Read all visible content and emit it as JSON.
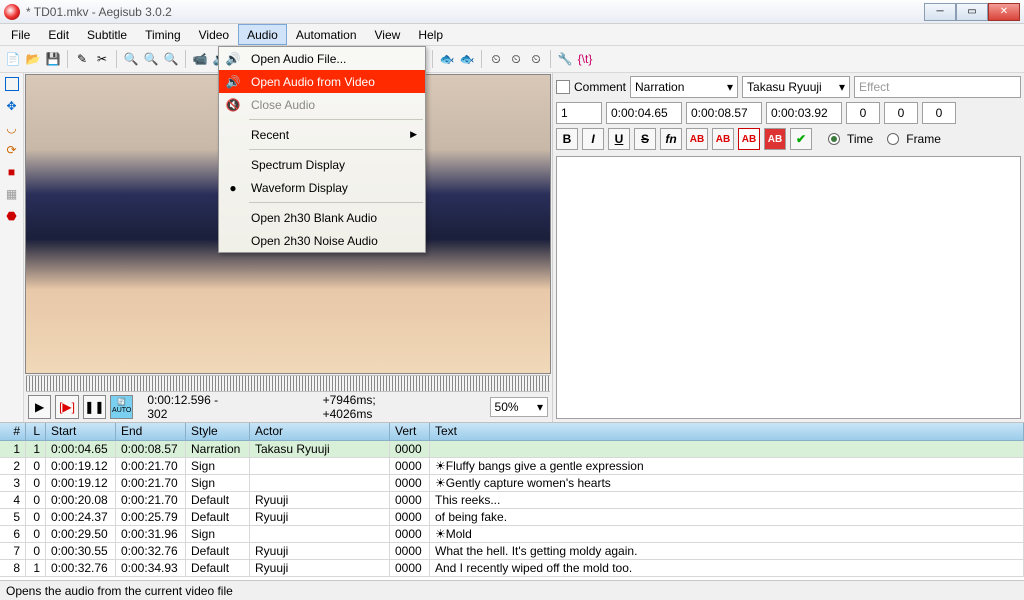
{
  "title": "* TD01.mkv - Aegisub 3.0.2",
  "menus": [
    "File",
    "Edit",
    "Subtitle",
    "Timing",
    "Video",
    "Audio",
    "Automation",
    "View",
    "Help"
  ],
  "audio_menu": {
    "open_file": "Open Audio File...",
    "open_from_video": "Open Audio from Video",
    "close": "Close Audio",
    "recent": "Recent",
    "spectrum": "Spectrum Display",
    "waveform": "Waveform Display",
    "blank": "Open 2h30 Blank Audio",
    "noise": "Open 2h30 Noise Audio"
  },
  "playback": {
    "timecode": "0:00:12.596 - 302",
    "offset": "+7946ms; +4026ms",
    "zoom": "50%"
  },
  "editpanel": {
    "comment_label": "Comment",
    "style": "Narration",
    "actor": "Takasu Ryuuji",
    "effect_ph": "Effect",
    "layer": "1",
    "start": "0:00:04.65",
    "end": "0:00:08.57",
    "dur": "0:00:03.92",
    "ml": "0",
    "mr": "0",
    "mv": "0",
    "time_label": "Time",
    "frame_label": "Frame"
  },
  "grid": {
    "headers": {
      "n": "#",
      "l": "L",
      "start": "Start",
      "end": "End",
      "style": "Style",
      "actor": "Actor",
      "vert": "Vert",
      "text": "Text"
    },
    "rows": [
      {
        "n": "1",
        "l": "1",
        "s": "0:00:04.65",
        "e": "0:00:08.57",
        "st": "Narration",
        "a": "Takasu Ryuuji",
        "v": "0000",
        "t": ""
      },
      {
        "n": "2",
        "l": "0",
        "s": "0:00:19.12",
        "e": "0:00:21.70",
        "st": "Sign",
        "a": "",
        "v": "0000",
        "t": "☀Fluffy bangs give a gentle expression"
      },
      {
        "n": "3",
        "l": "0",
        "s": "0:00:19.12",
        "e": "0:00:21.70",
        "st": "Sign",
        "a": "",
        "v": "0000",
        "t": "☀Gently capture women's hearts"
      },
      {
        "n": "4",
        "l": "0",
        "s": "0:00:20.08",
        "e": "0:00:21.70",
        "st": "Default",
        "a": "Ryuuji",
        "v": "0000",
        "t": "This reeks..."
      },
      {
        "n": "5",
        "l": "0",
        "s": "0:00:24.37",
        "e": "0:00:25.79",
        "st": "Default",
        "a": "Ryuuji",
        "v": "0000",
        "t": "of being fake."
      },
      {
        "n": "6",
        "l": "0",
        "s": "0:00:29.50",
        "e": "0:00:31.96",
        "st": "Sign",
        "a": "",
        "v": "0000",
        "t": "☀Mold"
      },
      {
        "n": "7",
        "l": "0",
        "s": "0:00:30.55",
        "e": "0:00:32.76",
        "st": "Default",
        "a": "Ryuuji",
        "v": "0000",
        "t": "What the hell. It's getting moldy again."
      },
      {
        "n": "8",
        "l": "1",
        "s": "0:00:32.76",
        "e": "0:00:34.93",
        "st": "Default",
        "a": "Ryuuji",
        "v": "0000",
        "t": "And I recently wiped off the mold too."
      }
    ]
  },
  "status": "Opens the audio from the current video file"
}
